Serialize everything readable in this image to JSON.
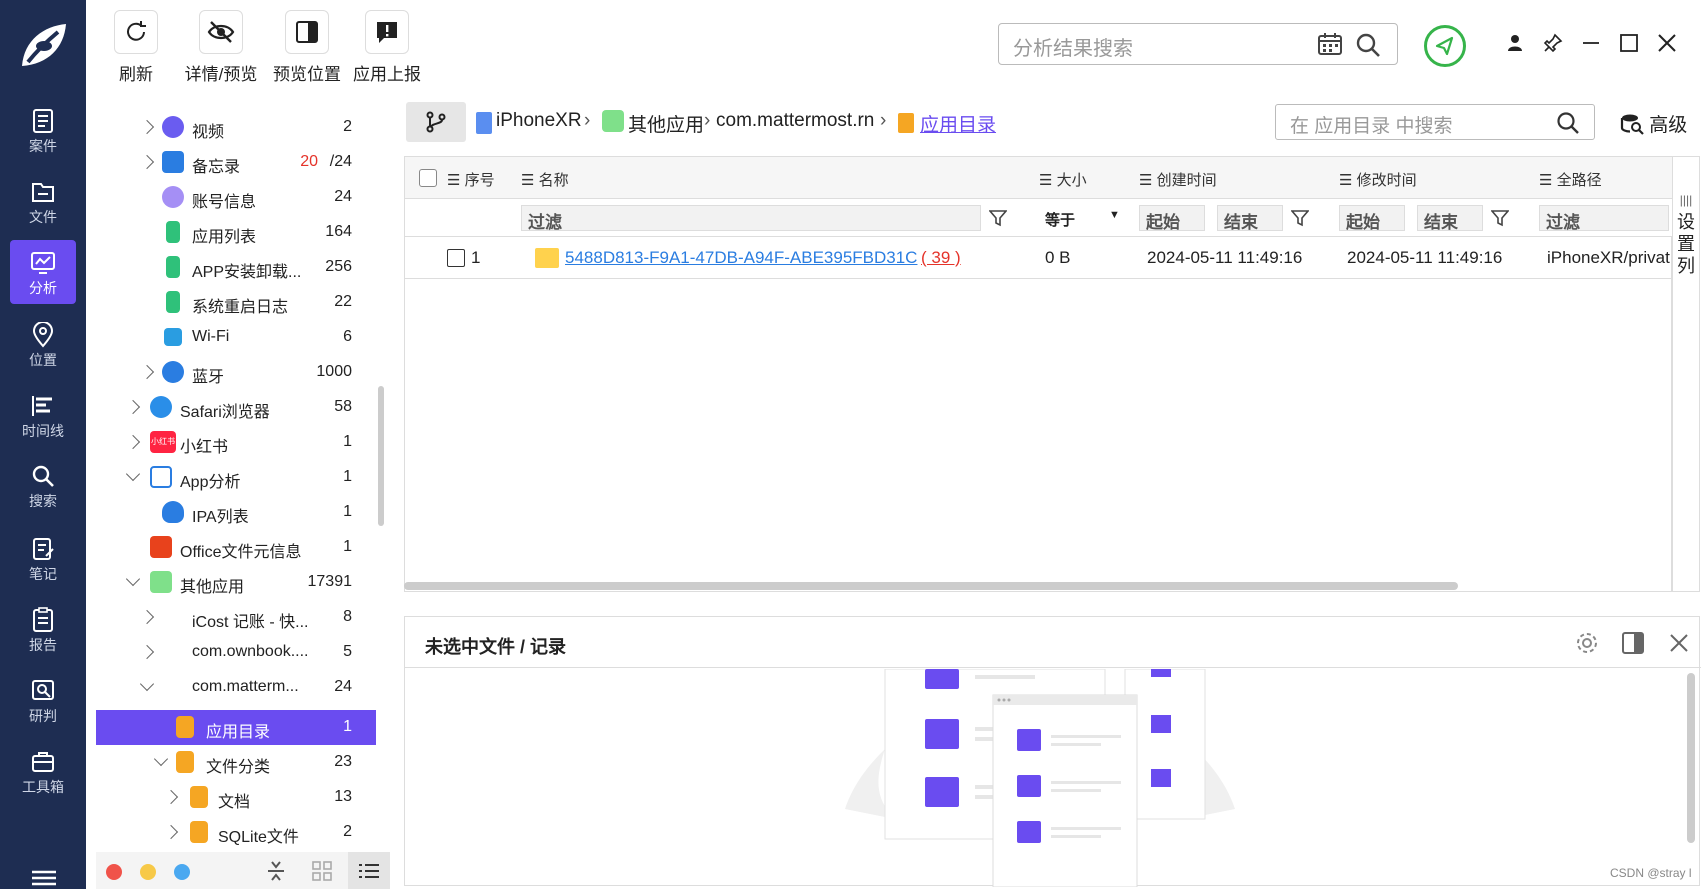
{
  "colors": {
    "nav_bg": "#1e2d52",
    "accent": "#6a4cf0",
    "link": "#2a7de1",
    "count_red": "#e5332a",
    "green": "#36b44a"
  },
  "nav": {
    "items": [
      {
        "label": "案件",
        "icon": "document-icon"
      },
      {
        "label": "文件",
        "icon": "folder-icon"
      },
      {
        "label": "分析",
        "icon": "analysis-icon",
        "active": true
      },
      {
        "label": "位置",
        "icon": "location-icon"
      },
      {
        "label": "时间线",
        "icon": "timeline-icon"
      },
      {
        "label": "搜索",
        "icon": "search-icon"
      },
      {
        "label": "笔记",
        "icon": "note-icon"
      },
      {
        "label": "报告",
        "icon": "report-icon"
      },
      {
        "label": "研判",
        "icon": "judge-icon"
      },
      {
        "label": "工具箱",
        "icon": "toolbox-icon"
      }
    ]
  },
  "toolbar": {
    "refresh": "刷新",
    "details": "详情/预览",
    "preview_pos": "预览位置",
    "report": "应用上报",
    "search_placeholder": "分析结果搜索"
  },
  "tree": {
    "rows": [
      {
        "label": "视频",
        "count": "2"
      },
      {
        "label": "备忘录",
        "count_red": "20",
        "count": "/24"
      },
      {
        "label": "账号信息",
        "count": "24"
      },
      {
        "label": "应用列表",
        "count": "164"
      },
      {
        "label": "APP安装卸载...",
        "count": "256"
      },
      {
        "label": "系统重启日志",
        "count": "22"
      },
      {
        "label": "Wi-Fi",
        "count": "6"
      },
      {
        "label": "蓝牙",
        "count": "1000"
      },
      {
        "label": "Safari浏览器",
        "count": "58"
      },
      {
        "label": "小红书",
        "count": "1"
      },
      {
        "label": "App分析",
        "count": "1"
      },
      {
        "label": "IPA列表",
        "count": "1"
      },
      {
        "label": "Office文件元信息",
        "count": "1"
      },
      {
        "label": "其他应用",
        "count": "17391"
      },
      {
        "label": "iCost 记账 - 快...",
        "count": "8"
      },
      {
        "label": "com.ownbook....",
        "count": "5"
      },
      {
        "label": "com.matterm...",
        "count": "24"
      },
      {
        "label": "应用目录",
        "count": "1"
      },
      {
        "label": "文件分类",
        "count": "23"
      },
      {
        "label": "文档",
        "count": "13"
      },
      {
        "label": "SQLite文件",
        "count": "2"
      }
    ],
    "xhs_logo": "小红书"
  },
  "breadcrumb": {
    "device": "iPhoneXR",
    "group": "其他应用",
    "app": "com.mattermost.rn",
    "current": "应用目录"
  },
  "mid_search": {
    "placeholder": "在 应用目录 中搜索",
    "advanced": "高级"
  },
  "grid": {
    "headers": {
      "index": "序号",
      "name": "名称",
      "size": "大小",
      "created": "创建时间",
      "modified": "修改时间",
      "path": "全路径"
    },
    "filters": {
      "name": "过滤",
      "size": "等于",
      "start": "起始",
      "end": "结束",
      "path": "过滤"
    },
    "rows": [
      {
        "index": "1",
        "name": "5488D813-F9A1-47DB-A94F-ABE395FBD31C",
        "count": "( 39 )",
        "size": "0 B",
        "created": "2024-05-11 11:49:16",
        "modified": "2024-05-11 11:49:16",
        "path": "iPhoneXR/privat"
      }
    ],
    "settings_col": "设置列"
  },
  "detail": {
    "title": "未选中文件 / 记录"
  },
  "watermark": "CSDN @stray l"
}
